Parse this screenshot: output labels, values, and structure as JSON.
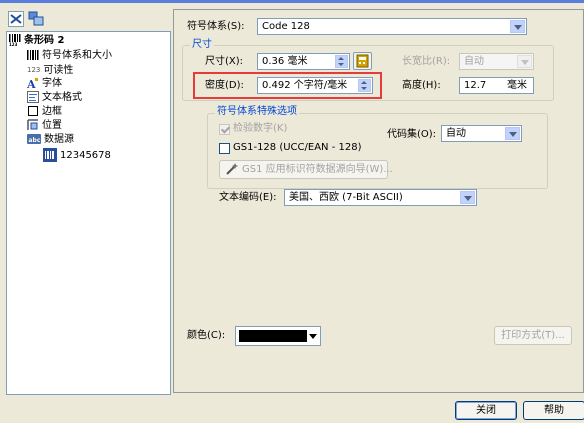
{
  "tree": {
    "root": "条形码 2",
    "items": [
      {
        "label": "符号体系和大小",
        "icon": "barcode-icon"
      },
      {
        "label": "可读性",
        "icon": "readable-123-icon"
      },
      {
        "label": "字体",
        "icon": "font-icon"
      },
      {
        "label": "文本格式",
        "icon": "text-format-icon"
      },
      {
        "label": "边框",
        "icon": "border-icon"
      },
      {
        "label": "位置",
        "icon": "position-icon"
      },
      {
        "label": "数据源",
        "icon": "datasource-icon"
      },
      {
        "label": "12345678",
        "icon": "data-value-icon"
      }
    ]
  },
  "symbology": {
    "label": "符号体系(S):",
    "value": "Code 128"
  },
  "size_group": {
    "title": "尺寸",
    "size_label": "尺寸(X):",
    "size_value": "0.36 毫米",
    "aspect_label": "长宽比(R):",
    "aspect_value": "自动",
    "density_label": "密度(D):",
    "density_value": "0.492 个字符/毫米",
    "height_label": "高度(H):",
    "height_value": "12.7",
    "height_unit": "毫米"
  },
  "special_group": {
    "title": "符号体系特殊选项",
    "checkdigit_label": "检验数字(K)",
    "gs1_label": "GS1-128 (UCC/EAN - 128)",
    "codeset_label": "代码集(O):",
    "codeset_value": "自动",
    "wizard_label": "GS1 应用标识符数据源向导(W)...",
    "encoding_label": "文本编码(E):",
    "encoding_value": "美国、西欧 (7-Bit ASCII)"
  },
  "color": {
    "label": "颜色(C):",
    "value": "#000000"
  },
  "print_method_label": "打印方式(T)...",
  "buttons": {
    "close": "关闭",
    "help": "帮助"
  },
  "colors": {
    "highlight": "#e53b3b",
    "tree_border": "#7f9db9",
    "dialog_bg": "#ece9d8"
  }
}
